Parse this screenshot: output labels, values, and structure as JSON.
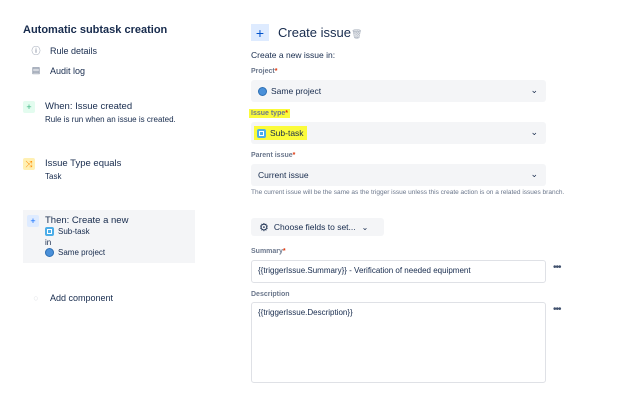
{
  "sidebar": {
    "title": "Automatic subtask creation",
    "links": [
      {
        "label": "Rule details",
        "icon": "info-icon"
      },
      {
        "label": "Audit log",
        "icon": "document-icon"
      }
    ],
    "trigger": {
      "title": "When: Issue created",
      "subtitle": "Rule is run when an issue is created.",
      "icon": "plus-icon",
      "color": "#36b37e"
    },
    "condition": {
      "title": "Issue Type equals",
      "subtitle": "Task",
      "icon": "shuffle-icon",
      "color": "#ffab00"
    },
    "action": {
      "title": "Then: Create a new",
      "issue_type": "Sub-task",
      "in": "in",
      "project": "Same project",
      "icon": "plus-icon",
      "color": "#0065ff"
    },
    "add_component": "Add component"
  },
  "main": {
    "title": "Create issue",
    "intro": "Create a new issue in:",
    "project": {
      "label": "Project",
      "required": "*",
      "value": "Same project"
    },
    "issue_type": {
      "label": "Issue type",
      "required": "*",
      "value": "Sub-task"
    },
    "parent": {
      "label": "Parent issue",
      "required": "*",
      "value": "Current issue",
      "help": "The current issue will be the same as the trigger issue unless this create action is on a related issues branch."
    },
    "choose_fields": "Choose fields to set...",
    "summary": {
      "label": "Summary",
      "required": "*",
      "value": "{{triggerIssue.Summary}} - Verification of needed equipment"
    },
    "description": {
      "label": "Description",
      "value": "{{triggerIssue.Description}}"
    },
    "more": "•••"
  },
  "colors": {
    "accent": "#0052cc",
    "highlight": "#fbfb3a",
    "panel": "#f4f5f7"
  }
}
